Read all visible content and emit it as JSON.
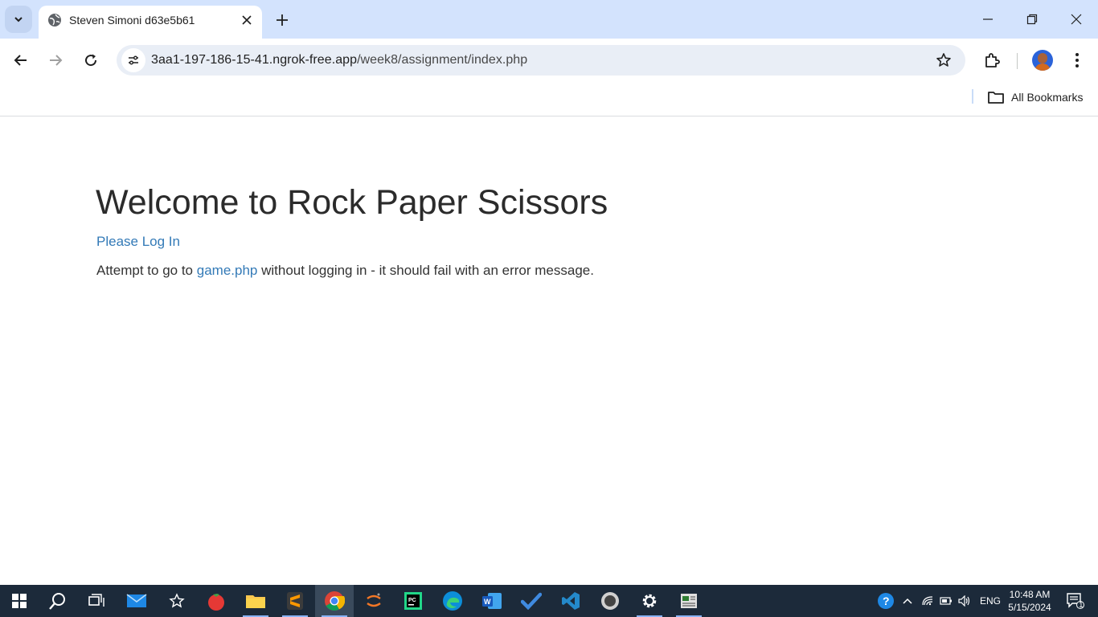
{
  "browser": {
    "tab": {
      "title": "Steven Simoni d63e5b61"
    },
    "url": {
      "host": "3aa1-197-186-15-41.ngrok-free.app",
      "path": "/week8/assignment/index.php"
    },
    "bookmarks": {
      "all_label": "All Bookmarks"
    }
  },
  "page": {
    "heading": "Welcome to Rock Paper Scissors",
    "login_link": "Please Log In",
    "attempt_prefix": "Attempt to go to ",
    "attempt_link": "game.php",
    "attempt_suffix": " without logging in - it should fail with an error message."
  },
  "taskbar": {
    "apps": [
      "start-icon",
      "search-icon",
      "task-view-icon",
      "mail-icon",
      "star-app-icon",
      "tomato-icon",
      "file-explorer-icon",
      "sublime-text-icon",
      "chrome-icon",
      "jupyter-icon",
      "pycharm-icon",
      "edge-icon",
      "word-icon",
      "todo-icon",
      "vscode-icon",
      "github-desktop-icon",
      "settings-icon",
      "news-icon"
    ],
    "language": "ENG",
    "time": "10:48 AM",
    "date": "5/15/2024",
    "notifications_count": "1"
  },
  "colors": {
    "link": "#337ab7",
    "tabstrip": "#d3e3fd",
    "taskbar": "#1c2a3a"
  }
}
